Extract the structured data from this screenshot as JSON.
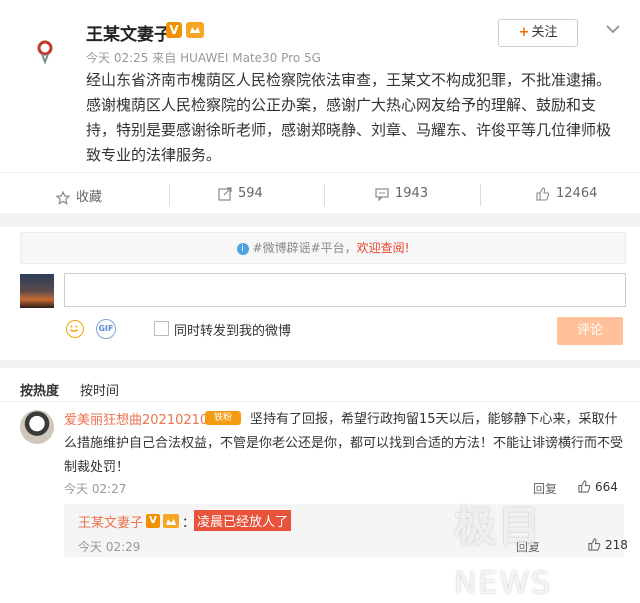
{
  "post": {
    "author": "王某文妻子",
    "vip_badge": "V",
    "follow_label": "关注",
    "follow_plus": "+",
    "time": "今天 02:25",
    "source_prefix": "来自",
    "device": "HUAWEI Mate30 Pro 5G",
    "content": "经山东省济南市槐荫区人民检察院依法审查，王某文不构成犯罪，不批准逮捕。感谢槐荫区人民检察院的公正办案，感谢广大热心网友给予的理解、鼓励和支持，特别是要感谢徐昕老师，感谢郑晓静、刘章、马耀东、许俊平等几位律师极致专业的法律服务。"
  },
  "actions": {
    "favorite_label": "收藏",
    "repost_count": "594",
    "comment_count": "1943",
    "like_count": "12464"
  },
  "rumor_banner": {
    "prefix": "#微博辟谣#平台，",
    "link": "欢迎查阅!"
  },
  "composer": {
    "repost_checkbox_label": "同时转发到我的微博",
    "submit_label": "评论"
  },
  "tabs": {
    "hot": "按热度",
    "time": "按时间"
  },
  "comment": {
    "author": "爱美丽狂想曲20210210",
    "level_badge": "铁粉",
    "text": "坚持有了回报，希望行政拘留15天以后，能够静下心来，采取什么措施维护自己合法权益，不管是你老公还是你，都可以找到合适的方法！不能让诽谤横行而不受制裁处罚！",
    "time": "今天 02:27",
    "reply_label": "回复",
    "likes": "664"
  },
  "sub_reply": {
    "author": "王某文妻子",
    "vip_badge": "V",
    "colon": "：",
    "text": "凌晨已经放人了",
    "time": "今天 02:29",
    "reply_label": "回复",
    "likes": "218"
  },
  "watermark": {
    "cn": "极目",
    "en": "NEWS"
  },
  "colors": {
    "accent": "#eb7350",
    "highlight": "#e9533c",
    "link_red": "#e8422b",
    "submit_disabled": "#ffc09a"
  }
}
